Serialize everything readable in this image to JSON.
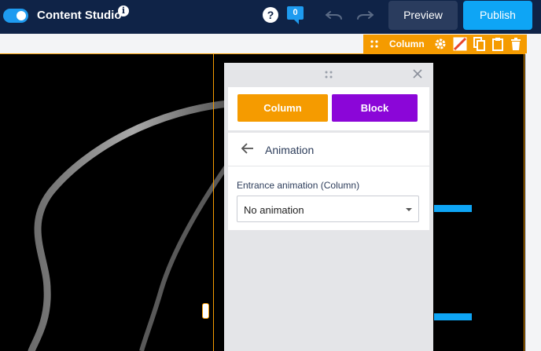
{
  "topbar": {
    "toggle_on": true,
    "app_title": "Content Studio",
    "info_glyph": "i",
    "help_glyph": "?",
    "comment_count": "0",
    "preview_label": "Preview",
    "publish_label": "Publish",
    "icons": [
      "toggle-switch",
      "info-icon",
      "help-icon",
      "comment-icon",
      "undo-icon",
      "redo-icon"
    ]
  },
  "column_toolbar": {
    "label": "Column",
    "icons": [
      "drag-icon",
      "gear-icon",
      "no-background-icon",
      "copy-icon",
      "paste-icon",
      "trash-icon"
    ]
  },
  "panel": {
    "tabs": {
      "column": "Column",
      "block": "Block"
    },
    "section_title": "Animation",
    "field_label": "Entrance animation (Column)",
    "select_value": "No animation",
    "icons": [
      "drag-icon",
      "close-icon",
      "back-arrow-icon",
      "chevron-down-icon"
    ]
  },
  "colors": {
    "topbar_bg": "#0f2347",
    "accent_blue": "#0ea5f5",
    "column_orange": "#f59b00",
    "block_purple": "#8b06d8",
    "panel_bg": "#e4e5e8"
  }
}
